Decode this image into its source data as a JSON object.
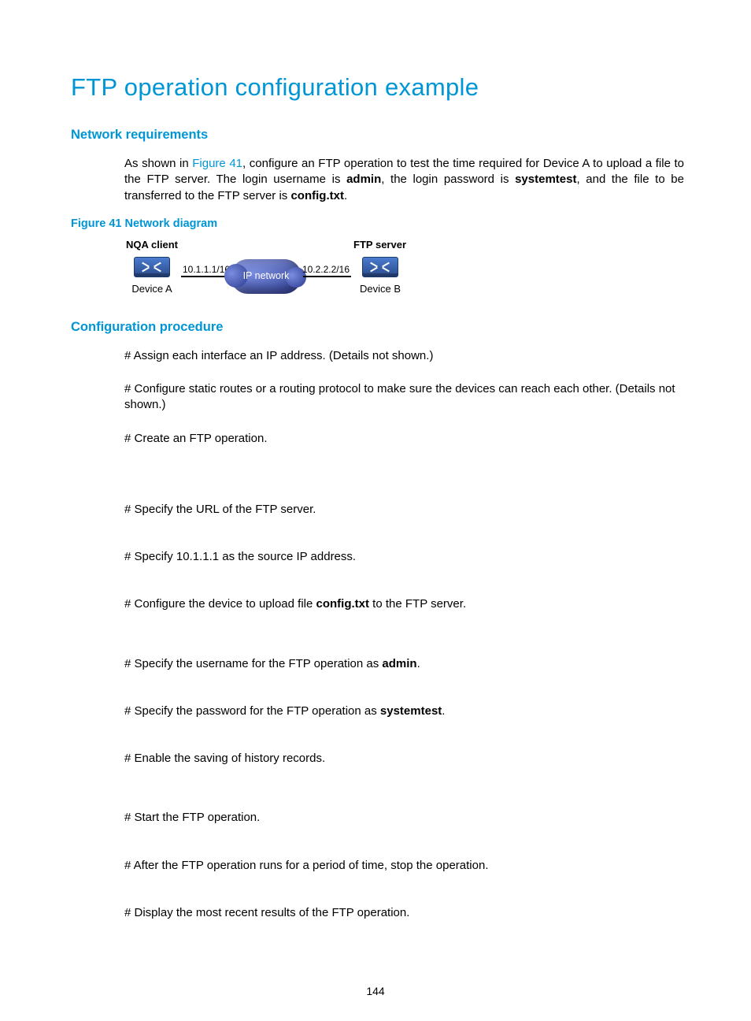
{
  "title": "FTP operation configuration example",
  "sections": {
    "req_heading": "Network requirements",
    "req_para_pre": "As shown in ",
    "req_para_link": "Figure 41",
    "req_para_mid": ", configure an FTP operation to test the time required for Device A to upload a file to the FTP server. The login username is ",
    "req_b1": "admin",
    "req_para_mid2": ", the login password is ",
    "req_b2": "systemtest",
    "req_para_mid3": ", and the file to be transferred to the FTP server is ",
    "req_b3": "config.txt",
    "req_para_end": ".",
    "figure_caption": "Figure 41 Network diagram",
    "diagram": {
      "client_label": "NQA client",
      "server_label": "FTP server",
      "ip_left": "10.1.1.1/16",
      "ip_right": "10.2.2.2/16",
      "cloud": "IP network",
      "dev_a": "Device A",
      "dev_b": "Device B"
    },
    "proc_heading": "Configuration procedure",
    "steps": {
      "s1": "# Assign each interface an IP address. (Details not shown.)",
      "s2": "# Configure static routes or a routing protocol to make sure the devices can reach each other. (Details not shown.)",
      "s3": "# Create an FTP operation.",
      "s4": "# Specify the URL of the FTP server.",
      "s5": "# Specify 10.1.1.1 as the source IP address.",
      "s6_pre": "# Configure the device to upload file ",
      "s6_b": "config.txt",
      "s6_post": " to the FTP server.",
      "s7_pre": "# Specify the username for the FTP operation as ",
      "s7_b": "admin",
      "s7_post": ".",
      "s8_pre": "# Specify the password for the FTP operation as ",
      "s8_b": "systemtest",
      "s8_post": ".",
      "s9": "# Enable the saving of history records.",
      "s10": "# Start the FTP operation.",
      "s11": "# After the FTP operation runs for a period of time, stop the operation.",
      "s12": "# Display the most recent results of the FTP operation."
    }
  },
  "page_number": "144"
}
